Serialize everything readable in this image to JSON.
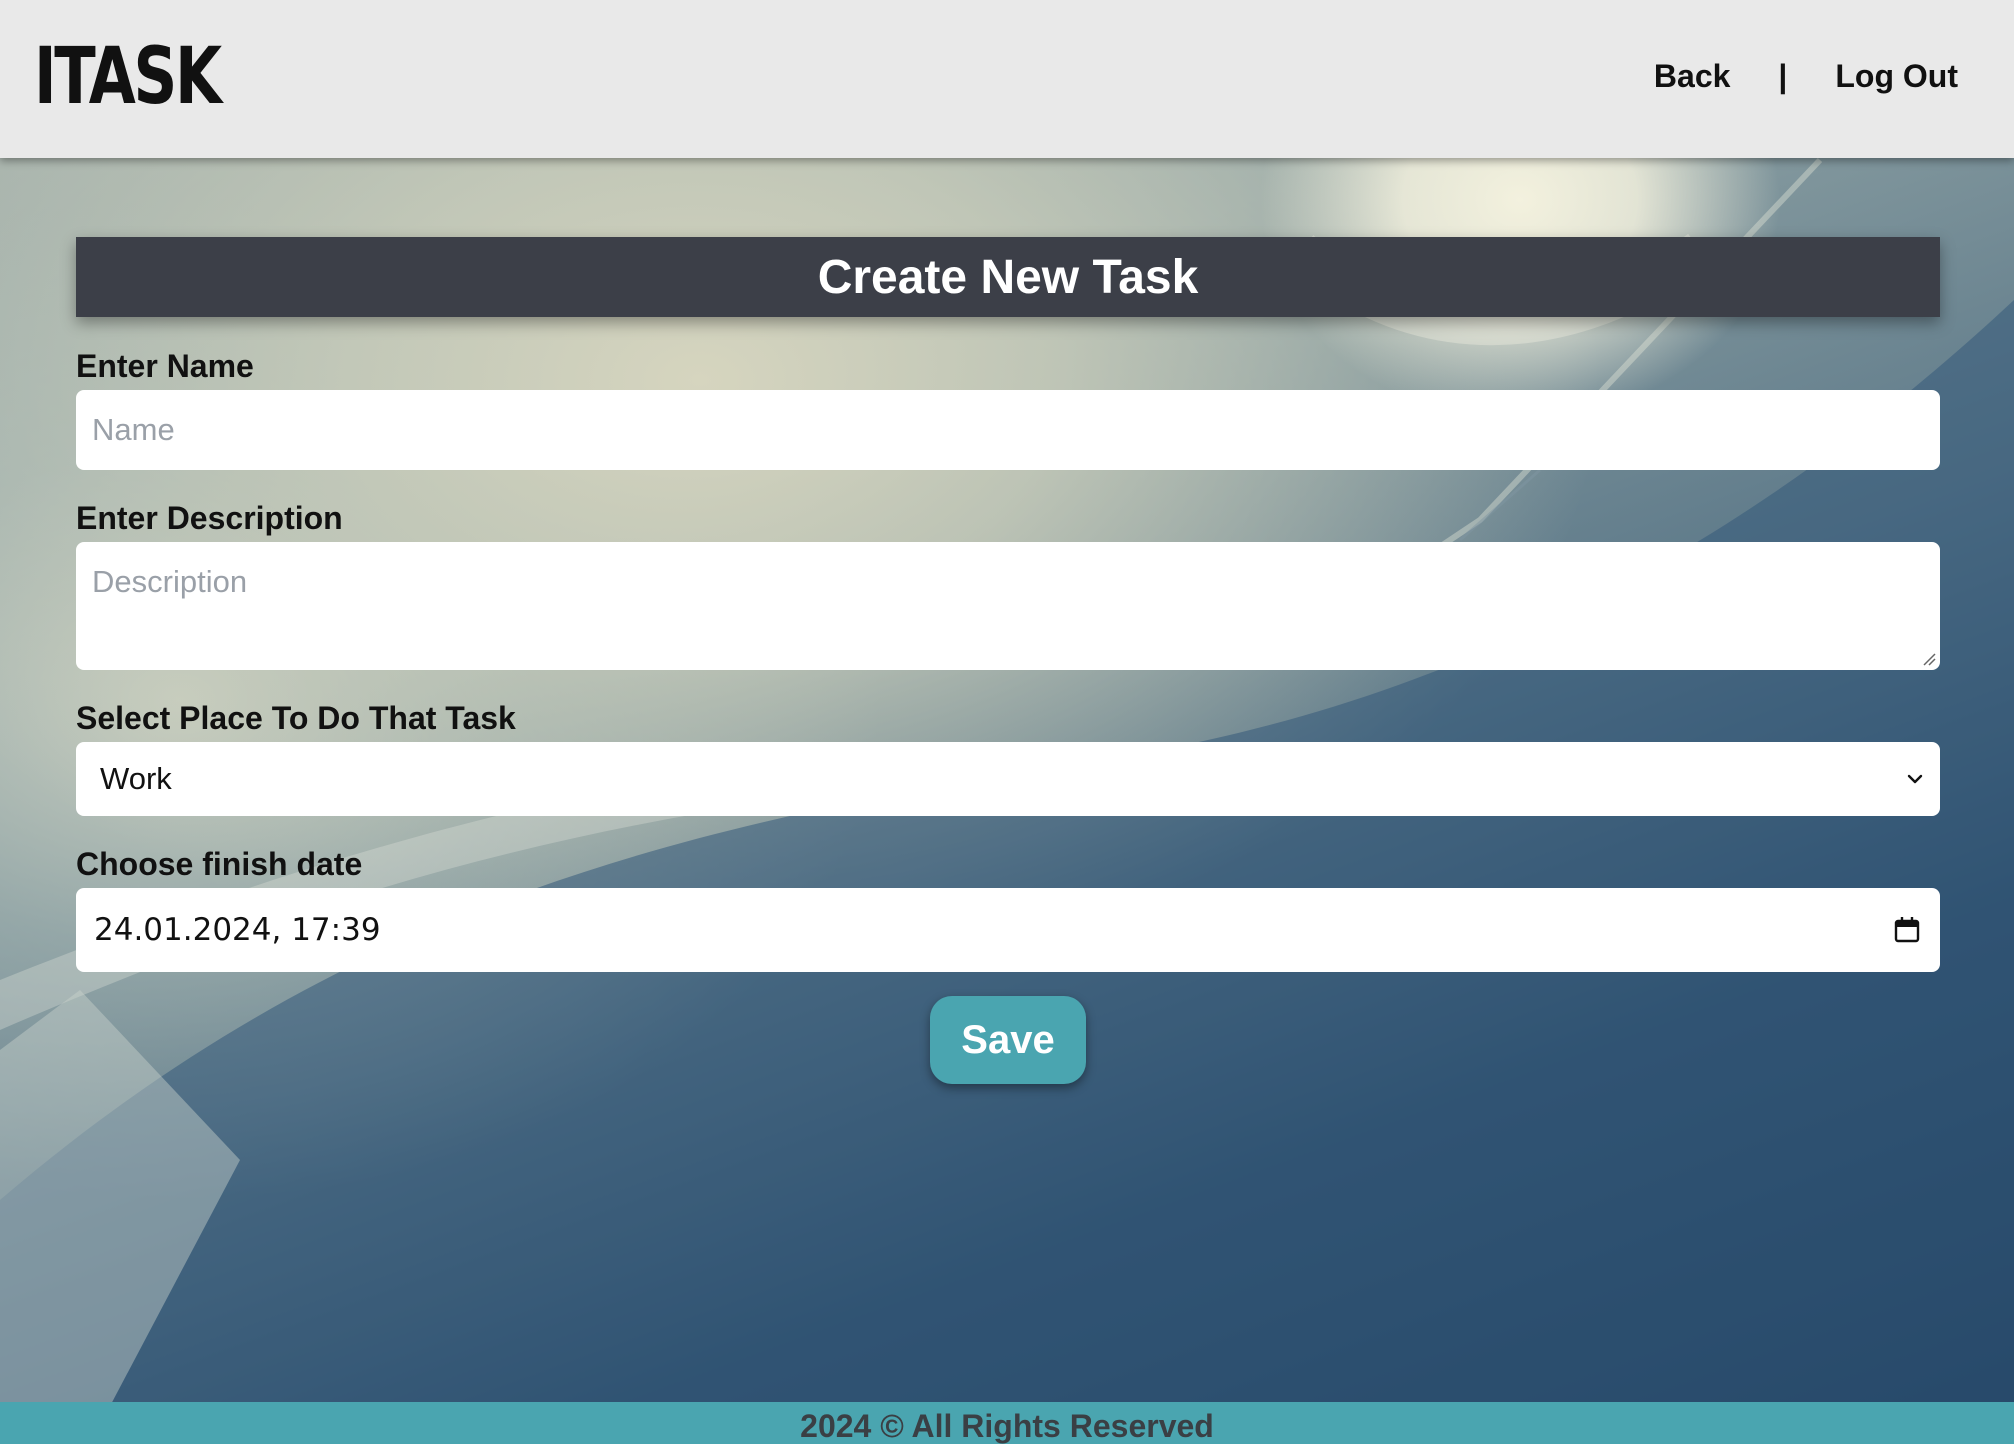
{
  "header": {
    "logo": "ITASK",
    "nav": {
      "back_label": "Back",
      "separator": "|",
      "logout_label": "Log Out"
    }
  },
  "form": {
    "title": "Create New Task",
    "name": {
      "label": "Enter Name",
      "placeholder": "Name",
      "value": ""
    },
    "description": {
      "label": "Enter Description",
      "placeholder": "Description",
      "value": ""
    },
    "place": {
      "label": "Select Place To Do That Task",
      "selected": "Work"
    },
    "finish_date": {
      "label": "Choose finish date",
      "value": "24.01.2024, 17:39"
    },
    "save_label": "Save"
  },
  "footer": {
    "text": "2024 © All Rights Reserved"
  },
  "colors": {
    "header_bg": "#e9e9e9",
    "title_bar_bg": "#3c3f48",
    "accent": "#4aa5b0",
    "footer_text": "#3a3f44"
  },
  "icons": {
    "select": "chevron-down-icon",
    "date": "calendar-icon"
  }
}
